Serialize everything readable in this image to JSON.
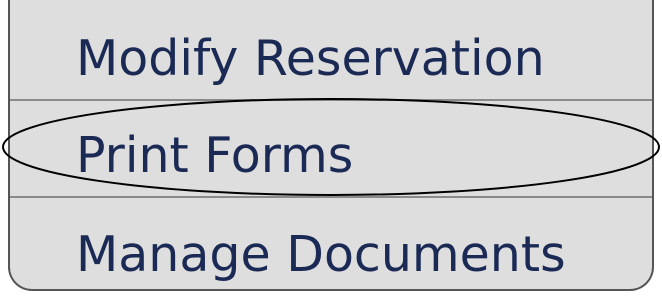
{
  "menu": {
    "items": [
      {
        "label": "Modify Reservation"
      },
      {
        "label": "Print Forms"
      },
      {
        "label": "Manage Documents"
      }
    ],
    "highlighted_item": "Print Forms"
  },
  "colors": {
    "panel_background": "#dedede",
    "text": "#1a2a55",
    "border": "#555555",
    "divider": "#8a8a8a",
    "highlight_outline": "#000000"
  }
}
